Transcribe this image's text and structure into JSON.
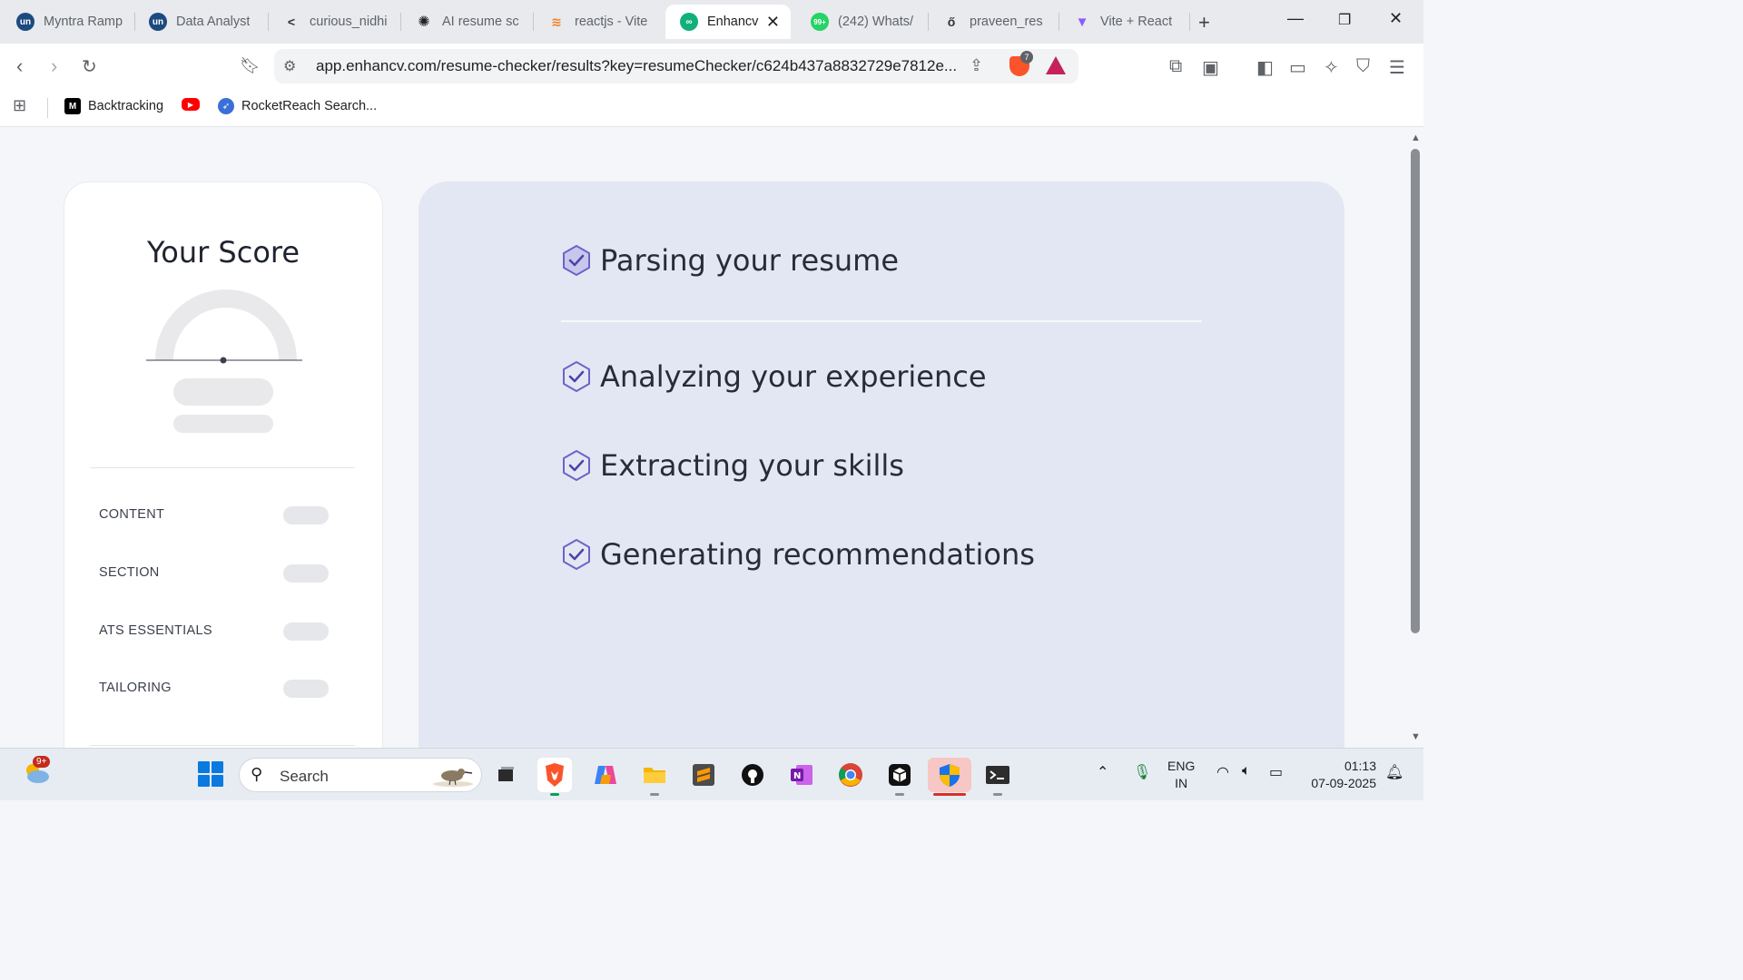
{
  "tabs": [
    {
      "label": "Myntra Ramp",
      "icon": "unstop-icon",
      "active": false
    },
    {
      "label": "Data Analyst",
      "icon": "unstop-icon",
      "active": false
    },
    {
      "label": "curious_nidhi",
      "icon": "leetcode-icon",
      "active": false
    },
    {
      "label": "AI resume sc",
      "icon": "openai-icon",
      "active": false
    },
    {
      "label": "reactjs - Vite",
      "icon": "stackoverflow-icon",
      "active": false
    },
    {
      "label": "Enhancv",
      "icon": "enhancv-icon",
      "active": true
    },
    {
      "label": "(242) Whats/",
      "icon": "whatsapp-icon",
      "active": false
    },
    {
      "label": "praveen_res",
      "icon": "leetcode-icon",
      "active": false
    },
    {
      "label": "Vite + React",
      "icon": "vite-icon",
      "active": false
    }
  ],
  "browser": {
    "url": "app.enhancv.com/resume-checker/results?key=resumeChecker/c624b437a8832729e7812e...",
    "shields_count": "7"
  },
  "bookmarks": [
    {
      "label": "Backtracking",
      "icon": "medium-icon"
    },
    {
      "label": "",
      "icon": "youtube-icon"
    },
    {
      "label": "RocketReach Search...",
      "icon": "rocketreach-icon"
    }
  ],
  "score": {
    "title": "Your Score",
    "categories": [
      "CONTENT",
      "SECTION",
      "ATS ESSENTIALS",
      "TAILORING"
    ]
  },
  "steps": [
    "Parsing your resume",
    "Analyzing your experience",
    "Extracting your skills",
    "Generating recommendations"
  ],
  "colors": {
    "accent": "#6c63c7",
    "panel": "#e3e7f3"
  },
  "taskbar": {
    "notification_badge": "9+",
    "search_placeholder": "Search",
    "lang_top": "ENG",
    "lang_bottom": "IN",
    "time": "01:13",
    "date": "07-09-2025"
  }
}
